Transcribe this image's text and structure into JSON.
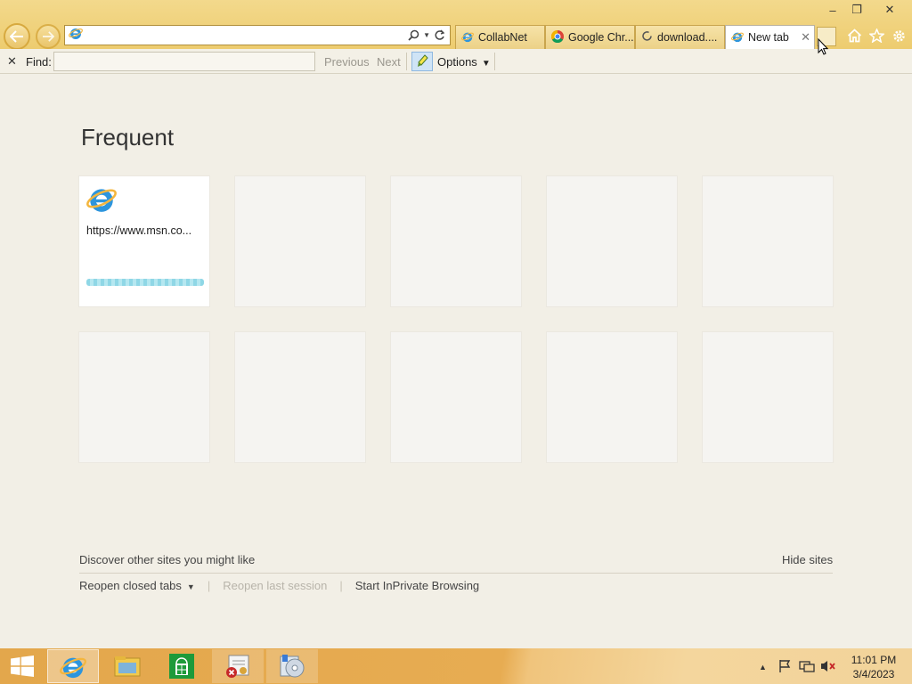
{
  "window": {
    "controls": {
      "minimize": "–",
      "restore": "❐",
      "close": "✕"
    }
  },
  "addressbar": {
    "value": "",
    "placeholder": ""
  },
  "tabs": [
    {
      "label": "CollabNet",
      "icon": "ie-icon"
    },
    {
      "label": "Google Chr...",
      "icon": "chrome-icon"
    },
    {
      "label": "download....",
      "icon": "loading-icon"
    },
    {
      "label": "New tab",
      "icon": "ie-icon",
      "active": true
    }
  ],
  "findbar": {
    "close": "✕",
    "label": "Find:",
    "value": "",
    "previous": "Previous",
    "next": "Next",
    "options": "Options"
  },
  "content": {
    "heading": "Frequent",
    "tiles": [
      {
        "url": "https://www.msn.co...",
        "filled": true
      },
      {
        "url": "",
        "filled": false
      },
      {
        "url": "",
        "filled": false
      },
      {
        "url": "",
        "filled": false
      },
      {
        "url": "",
        "filled": false
      },
      {
        "url": "",
        "filled": false
      },
      {
        "url": "",
        "filled": false
      },
      {
        "url": "",
        "filled": false
      },
      {
        "url": "",
        "filled": false
      },
      {
        "url": "",
        "filled": false
      }
    ],
    "discover": "Discover other sites you might like",
    "hide_sites": "Hide sites",
    "reopen_closed_tabs": "Reopen closed tabs",
    "reopen_last_session": "Reopen last session",
    "inprivate": "Start InPrivate Browsing"
  },
  "taskbar": {
    "clock_time": "11:01 PM",
    "clock_date": "3/4/2023"
  },
  "colors": {
    "frame": "#edcc6f",
    "page_bg": "#f2efe6",
    "taskbar": "#e3a74c",
    "ie_blue": "#1c8ad6"
  }
}
